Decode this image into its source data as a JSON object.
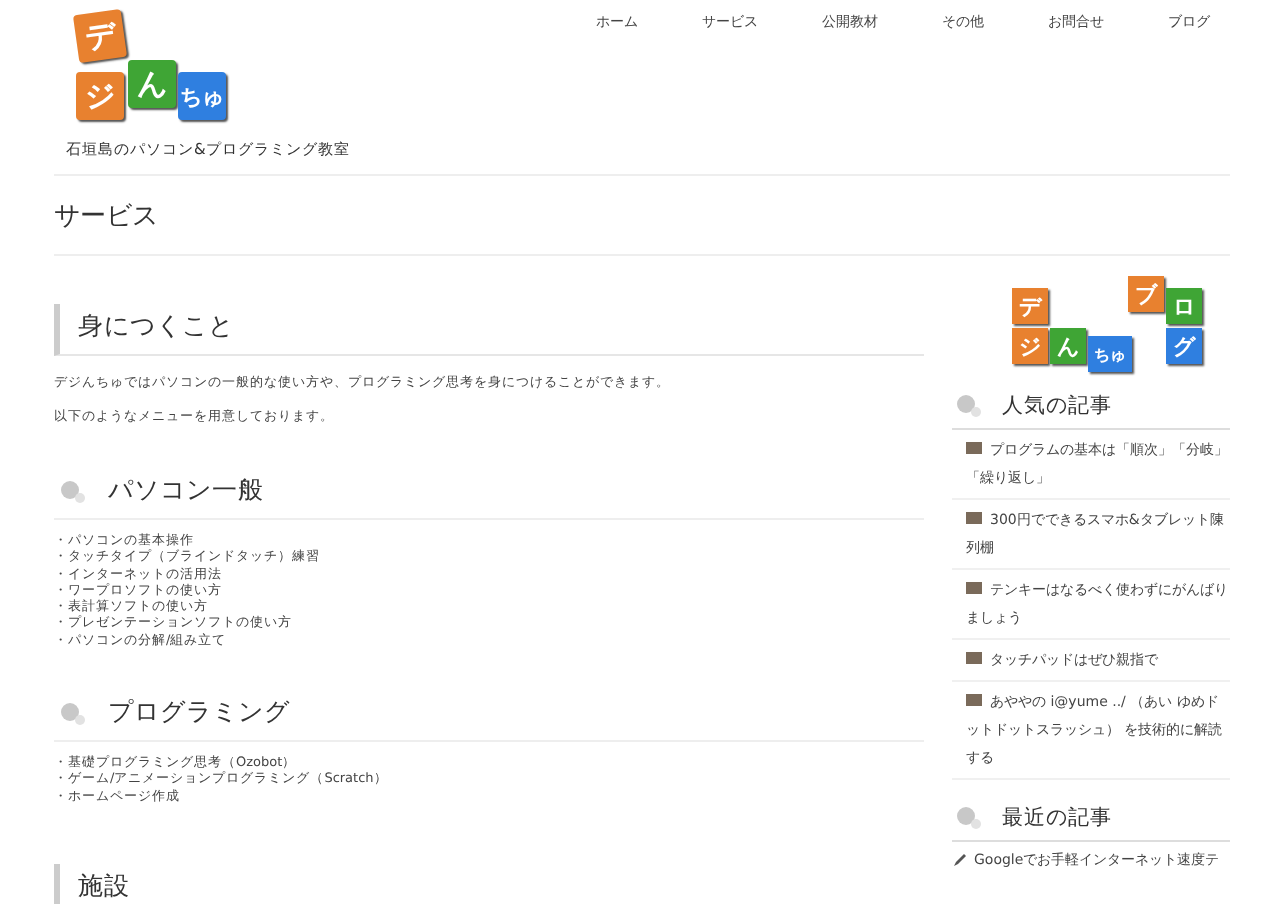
{
  "header": {
    "logo": {
      "chars": [
        "デ",
        "ジ",
        "ん",
        "ちゅ"
      ]
    },
    "tagline": "石垣島のパソコン&プログラミング教室",
    "nav": [
      {
        "label": "ホーム",
        "selected": false
      },
      {
        "label": "サービス",
        "selected": false
      },
      {
        "label": "公開教材",
        "selected": false
      },
      {
        "label": "その他",
        "selected": false
      },
      {
        "label": "お問合せ",
        "selected": false
      },
      {
        "label": "ブログ",
        "selected": false
      }
    ]
  },
  "page_title": "サービス",
  "sections": [
    {
      "kind": "bar",
      "heading": "身につくこと",
      "paragraphs": [
        "デジんちゅではパソコンの一般的な使い方や、プログラミング思考を身につけることができます。",
        "以下のようなメニューを用意しております。"
      ]
    },
    {
      "kind": "dot",
      "heading": "パソコン一般",
      "items": [
        "・パソコンの基本操作",
        "・タッチタイプ（ブラインドタッチ）練習",
        "・インターネットの活用法",
        "・ワープロソフトの使い方",
        "・表計算ソフトの使い方",
        "・プレゼンテーションソフトの使い方",
        "・パソコンの分解/組み立て"
      ]
    },
    {
      "kind": "dot",
      "heading": "プログラミング",
      "items": [
        "・基礎プログラミング思考（Ozobot）",
        "・ゲーム/アニメーションプログラミング（Scratch）",
        "・ホームページ作成"
      ]
    },
    {
      "kind": "bar",
      "heading": "施設"
    }
  ],
  "sidebar": {
    "blog_logo": {
      "chars": [
        "デ",
        "ジ",
        "ん",
        "ちゅ",
        "ブ",
        "ロ",
        "グ"
      ]
    },
    "popular": {
      "heading": "人気の記事",
      "articles": [
        {
          "title": "プログラムの基本は「順次」「分岐」「繰り返し」"
        },
        {
          "title": "300円でできるスマホ&タブレット陳列棚"
        },
        {
          "title": "テンキーはなるべく使わずにがんばりましょう"
        },
        {
          "title": "タッチパッドはぜひ親指で"
        },
        {
          "title": "あややの i@yume ../ （あい ゆめドットドットスラッシュ） を技術的に解読する"
        }
      ]
    },
    "recent": {
      "heading": "最近の記事",
      "articles": [
        {
          "title": "Googleでお手軽インターネット速度テ"
        }
      ]
    }
  }
}
